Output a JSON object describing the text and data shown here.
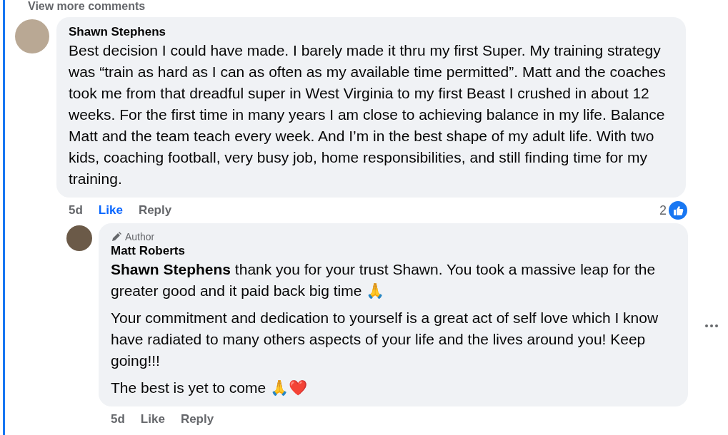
{
  "view_more": "View more comments",
  "comments": [
    {
      "author": "Shawn Stephens",
      "paragraphs": [
        "Best decision I could have made. I barely made it thru my first Super. My training strategy was “train as hard as I can as often as my available time permitted”. Matt and the coaches took me from that dreadful super in West Virginia to my first Beast I crushed in about 12 weeks. For the first time in many years I am close to achieving balance in my life. Balance Matt and the team teach every week. And I’m in the best shape of my adult life. With two kids, coaching football, very busy job, home responsibilities, and still finding time for my training."
      ],
      "time": "5d",
      "like": "Like",
      "liked": true,
      "reply": "Reply",
      "reactions": "2",
      "replies": [
        {
          "author": "Matt Roberts",
          "badge": "Author",
          "paragraphs": [
            "**Shawn Stephens** thank you for your trust Shawn. You took a massive leap for the greater good and it paid back big time 🙏",
            "Your commitment and dedication to yourself is a great act of self love which I know have radiated to many others aspects of your life and the lives around you! Keep going!!!",
            "The best is yet to come 🙏❤️"
          ],
          "time": "5d",
          "like": "Like",
          "liked": false,
          "reply": "Reply"
        }
      ]
    }
  ]
}
